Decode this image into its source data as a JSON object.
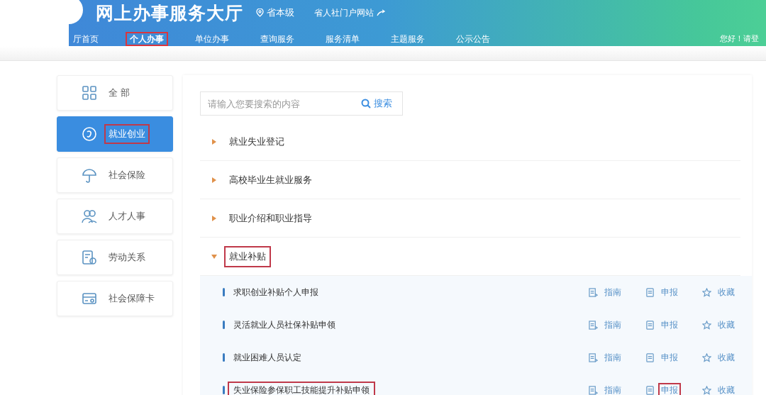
{
  "header": {
    "title": "网上办事服务大厅",
    "region": "省本级",
    "portal": "省人社门户网站"
  },
  "nav": [
    {
      "label": "厅首页",
      "selected": false,
      "highlighted": false
    },
    {
      "label": "个人办事",
      "selected": true,
      "highlighted": true
    },
    {
      "label": "单位办事",
      "selected": false,
      "highlighted": false
    },
    {
      "label": "查询服务",
      "selected": false,
      "highlighted": false
    },
    {
      "label": "服务清单",
      "selected": false,
      "highlighted": false
    },
    {
      "label": "主题服务",
      "selected": false,
      "highlighted": false
    },
    {
      "label": "公示公告",
      "selected": false,
      "highlighted": false
    }
  ],
  "greeting": "您好！请登",
  "sidebar": {
    "items": [
      {
        "label": "全 部",
        "selected": false,
        "highlighted": false
      },
      {
        "label": "就业创业",
        "selected": true,
        "highlighted": true
      },
      {
        "label": "社会保险",
        "selected": false,
        "highlighted": false
      },
      {
        "label": "人才人事",
        "selected": false,
        "highlighted": false
      },
      {
        "label": "劳动关系",
        "selected": false,
        "highlighted": false
      },
      {
        "label": "社会保障卡",
        "selected": false,
        "highlighted": false
      }
    ]
  },
  "search": {
    "placeholder": "请输入您要搜索的内容",
    "button": "搜索"
  },
  "categories": [
    {
      "label": "就业失业登记",
      "expanded": false,
      "highlighted": false
    },
    {
      "label": "高校毕业生就业服务",
      "expanded": false,
      "highlighted": false
    },
    {
      "label": "职业介绍和职业指导",
      "expanded": false,
      "highlighted": false
    },
    {
      "label": "就业补贴",
      "expanded": true,
      "highlighted": true,
      "children": [
        {
          "label": "求职创业补贴个人申报",
          "highlighted": false,
          "actions": [
            {
              "kind": "guide",
              "label": "指南",
              "highlighted": false
            },
            {
              "kind": "apply",
              "label": "申报",
              "highlighted": false
            },
            {
              "kind": "favorite",
              "label": "收藏",
              "highlighted": false
            }
          ]
        },
        {
          "label": "灵活就业人员社保补贴申领",
          "highlighted": false,
          "actions": [
            {
              "kind": "guide",
              "label": "指南",
              "highlighted": false
            },
            {
              "kind": "apply",
              "label": "申报",
              "highlighted": false
            },
            {
              "kind": "favorite",
              "label": "收藏",
              "highlighted": false
            }
          ]
        },
        {
          "label": "就业困难人员认定",
          "highlighted": false,
          "actions": [
            {
              "kind": "guide",
              "label": "指南",
              "highlighted": false
            },
            {
              "kind": "apply",
              "label": "申报",
              "highlighted": false
            },
            {
              "kind": "favorite",
              "label": "收藏",
              "highlighted": false
            }
          ]
        },
        {
          "label": "失业保险参保职工技能提升补贴申领",
          "highlighted": true,
          "actions": [
            {
              "kind": "guide",
              "label": "指南",
              "highlighted": false
            },
            {
              "kind": "apply",
              "label": "申报",
              "highlighted": true
            },
            {
              "kind": "favorite",
              "label": "收藏",
              "highlighted": false
            }
          ]
        }
      ]
    }
  ]
}
